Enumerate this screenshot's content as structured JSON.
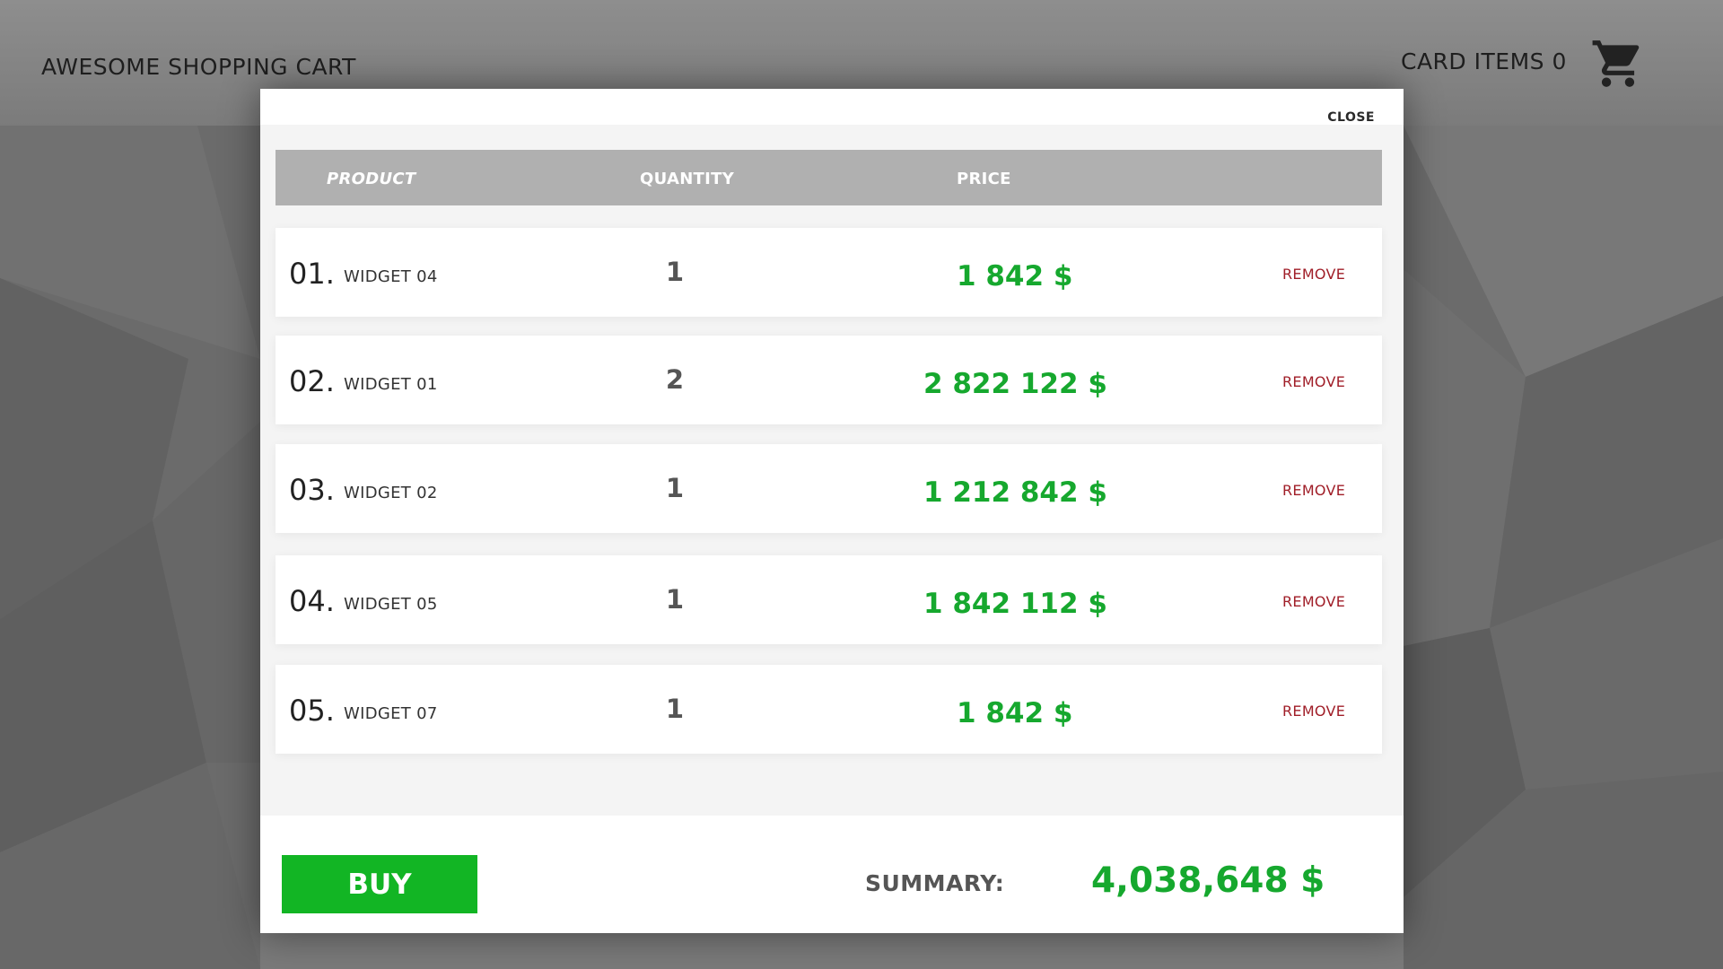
{
  "header": {
    "title": "AWESOME SHOPPING CART",
    "cart_label": "CARD ITEMS 0",
    "cart_icon": "cart-icon"
  },
  "modal": {
    "close_label": "CLOSE",
    "columns": {
      "product": "PRODUCT",
      "quantity": "QUANTITY",
      "price": "PRICE"
    },
    "items": [
      {
        "num": "01.",
        "name": "WIDGET 04",
        "qty": "1",
        "price": "1 842 $",
        "action": "REMOVE"
      },
      {
        "num": "02.",
        "name": "WIDGET 01",
        "qty": "2",
        "price": "2 822 122 $",
        "action": "REMOVE"
      },
      {
        "num": "03.",
        "name": "WIDGET 02",
        "qty": "1",
        "price": "1 212 842 $",
        "action": "REMOVE"
      },
      {
        "num": "04.",
        "name": "WIDGET 05",
        "qty": "1",
        "price": "1 842 112 $",
        "action": "REMOVE"
      },
      {
        "num": "05.",
        "name": "WIDGET 07",
        "qty": "1",
        "price": "1 842 $",
        "action": "REMOVE"
      }
    ],
    "buy_label": "BUY",
    "summary_label": "SUMMARY:",
    "summary_value": "4,038,648 $"
  },
  "colors": {
    "accent_green": "#12b524",
    "price_green": "#16a82e",
    "remove_red": "#a01e28",
    "header_gray": "#b0b0b0"
  }
}
